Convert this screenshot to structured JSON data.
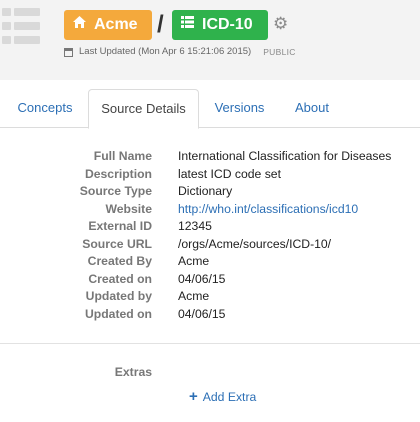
{
  "header": {
    "owner": {
      "label": "Acme",
      "icon": "home-icon",
      "color": "#f4a93c"
    },
    "separator": "/",
    "source": {
      "label": "ICD-10",
      "icon": "list-icon",
      "color": "#2fb24c"
    },
    "settings_icon": "gear-icon",
    "last_updated": "Last Updated (Mon Apr 6 15:21:06 2015)",
    "visibility": "PUBLIC"
  },
  "tabs": [
    {
      "label": "Concepts",
      "active": false
    },
    {
      "label": "Source Details",
      "active": true
    },
    {
      "label": "Versions",
      "active": false
    },
    {
      "label": "About",
      "active": false
    }
  ],
  "details": [
    {
      "label": "Full Name",
      "value": "International Classification for Diseases",
      "link": false
    },
    {
      "label": "Description",
      "value": "latest ICD code set",
      "link": false
    },
    {
      "label": "Source Type",
      "value": "Dictionary",
      "link": false
    },
    {
      "label": "Website",
      "value": "http://who.int/classifications/icd10",
      "link": true
    },
    {
      "label": "External ID",
      "value": "12345",
      "link": false
    },
    {
      "label": "Source URL",
      "value": "/orgs/Acme/sources/ICD-10/",
      "link": false
    },
    {
      "label": "Created By",
      "value": "Acme",
      "link": false
    },
    {
      "label": "Created on",
      "value": "04/06/15",
      "link": false
    },
    {
      "label": "Updated by",
      "value": "Acme",
      "link": false
    },
    {
      "label": "Updated on",
      "value": "04/06/15",
      "link": false
    }
  ],
  "extras": {
    "label": "Extras",
    "add_label": "Add Extra",
    "add_icon": "plus-icon"
  }
}
